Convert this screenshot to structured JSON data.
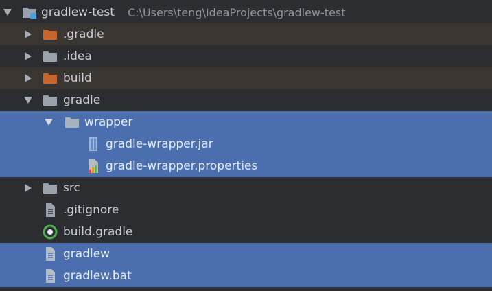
{
  "root": {
    "name": "gradlew-test",
    "path": "C:\\Users\\teng\\IdeaProjects\\gradlew-test"
  },
  "items": [
    {
      "label": ".gradle"
    },
    {
      "label": ".idea"
    },
    {
      "label": "build"
    },
    {
      "label": "gradle"
    },
    {
      "label": "wrapper"
    },
    {
      "label": "gradle-wrapper.jar"
    },
    {
      "label": "gradle-wrapper.properties"
    },
    {
      "label": "src"
    },
    {
      "label": ".gitignore"
    },
    {
      "label": "build.gradle"
    },
    {
      "label": "gradlew"
    },
    {
      "label": "gradlew.bat"
    }
  ],
  "colors": {
    "background": "#2b2d30",
    "selection": "#4b6eaf",
    "excluded_row": "#3a3531",
    "excluded_folder": "#c8642c",
    "folder": "#9aa3ad",
    "text": "#c9cdd3",
    "path_text": "#8f949b"
  },
  "icons": {
    "expand": "chevron-down-icon",
    "collapse": "chevron-right-icon",
    "folder": "folder-icon",
    "module": "module-folder-icon",
    "file": "text-file-icon",
    "jar": "jar-file-icon",
    "properties": "properties-file-icon",
    "gradle": "gradle-file-icon"
  }
}
